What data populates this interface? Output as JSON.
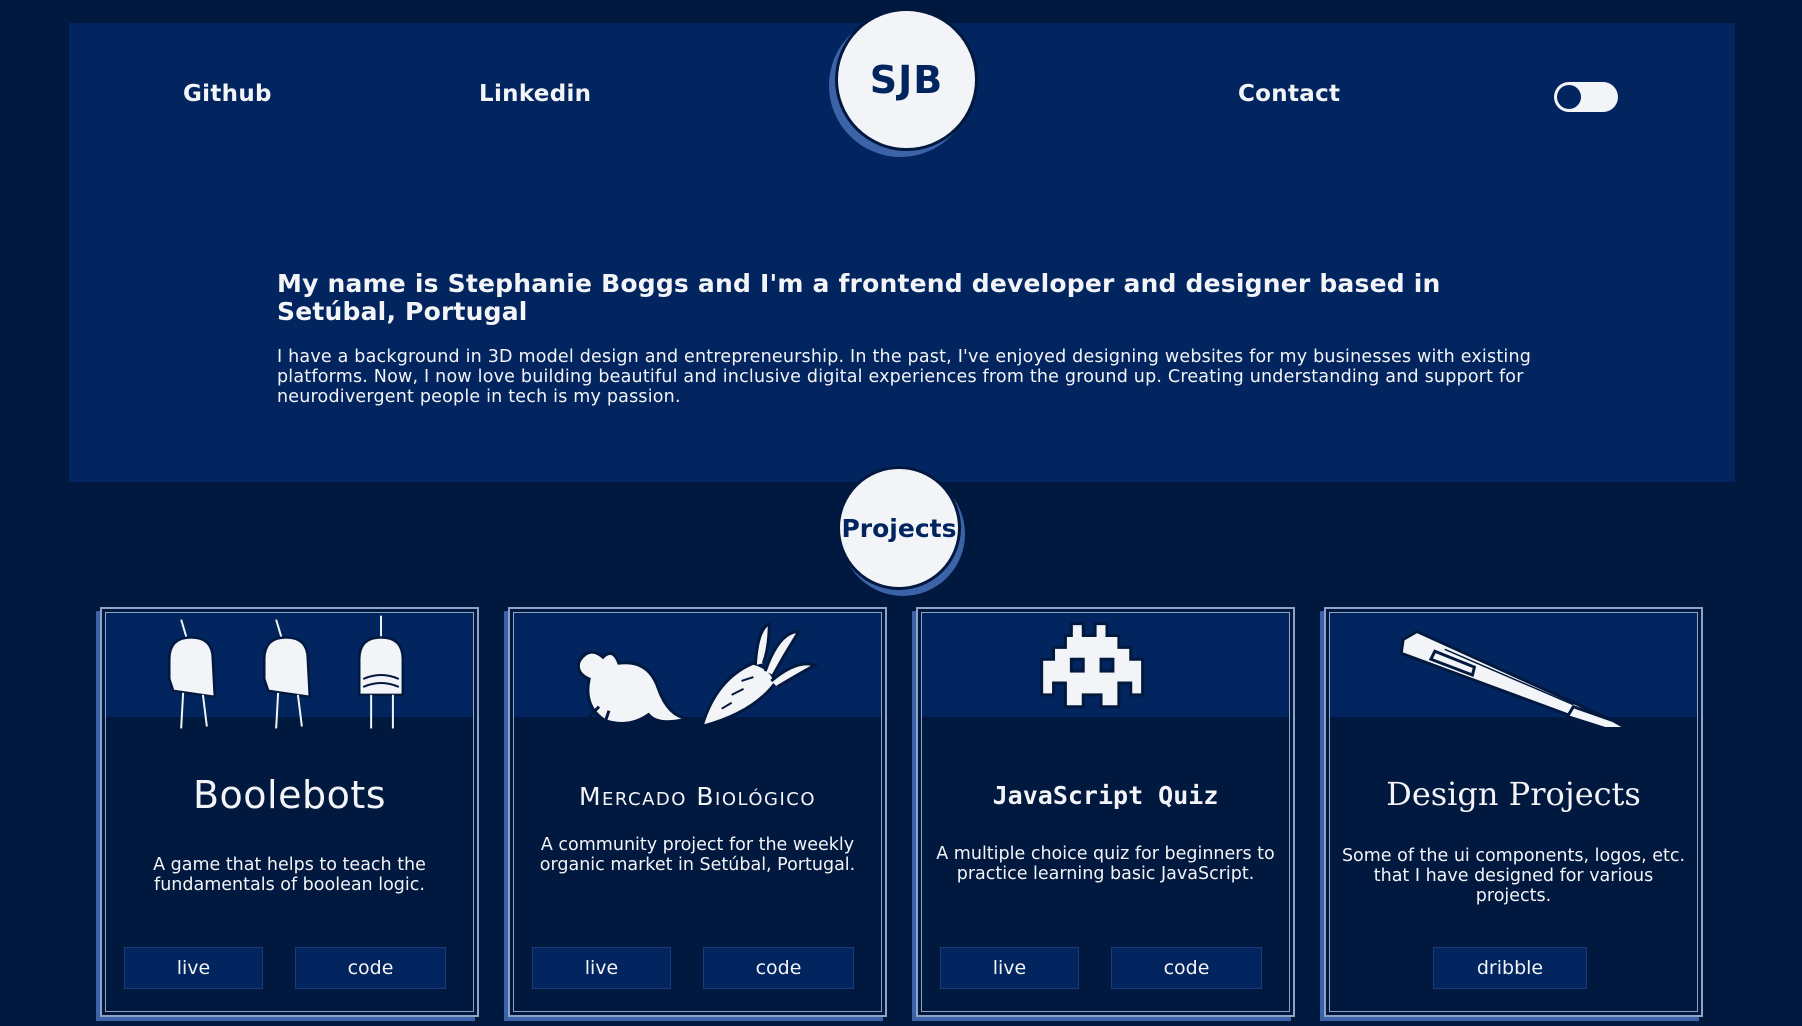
{
  "nav": {
    "github": "Github",
    "linkedin": "Linkedin",
    "logo": "SJB",
    "contact": "Contact"
  },
  "hero": {
    "headline": "My name is Stephanie Boggs and I'm a frontend developer and designer based in Setúbal, Portugal",
    "intro": "I have a background in 3D model design and entrepreneurship. In the past, I've enjoyed designing websites for my businesses with existing platforms. Now, I now love building beautiful and inclusive digital experiences from the ground up. Creating understanding and support for neurodivergent people in tech is my passion."
  },
  "projects_heading": "Projects",
  "projects": [
    {
      "title": "Boolebots",
      "icon": "robots-icon",
      "description": "A game that helps to teach the fundamentals of boolean logic.",
      "buttons": [
        "live",
        "code"
      ]
    },
    {
      "title": "Mercado Biológico",
      "icon": "vegetables-icon",
      "description": "A community project for the weekly organic market in Setúbal, Portugal.",
      "buttons": [
        "live",
        "code"
      ]
    },
    {
      "title": "JavaScript Quiz",
      "icon": "space-invader-icon",
      "description": "A multiple choice quiz for beginners to practice learning basic JavaScript.",
      "buttons": [
        "live",
        "code"
      ]
    },
    {
      "title": "Design Projects",
      "icon": "pen-icon",
      "description": "Some of the ui components, logos, etc. that I have designed for various projects.",
      "buttons": [
        "dribble"
      ]
    }
  ],
  "colors": {
    "background": "#01183f",
    "panel": "#02255f",
    "light": "#f3f4f7",
    "accent": "#3c63a8"
  }
}
